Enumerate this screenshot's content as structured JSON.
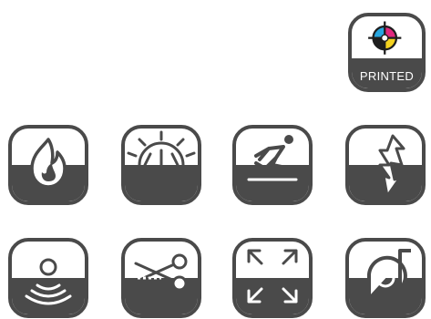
{
  "badge": {
    "label": "PRINTED",
    "icon": "registration-mark-icon",
    "colors": {
      "cyan": "#27a6e0",
      "magenta": "#e0297e",
      "yellow": "#f4d21f",
      "black": "#1e1e1e"
    }
  },
  "icons": {
    "row1": [
      "flammable-icon",
      "sunlight-icon",
      "slippery-icon",
      "shock-icon"
    ],
    "row2": [
      "sensor-icon",
      "cut-icon",
      "expand-icon",
      "centrifugal-fan-icon"
    ]
  },
  "palette": {
    "frame": "#4a4a4a",
    "band": "#4a4a4a",
    "background": "#ffffff"
  }
}
